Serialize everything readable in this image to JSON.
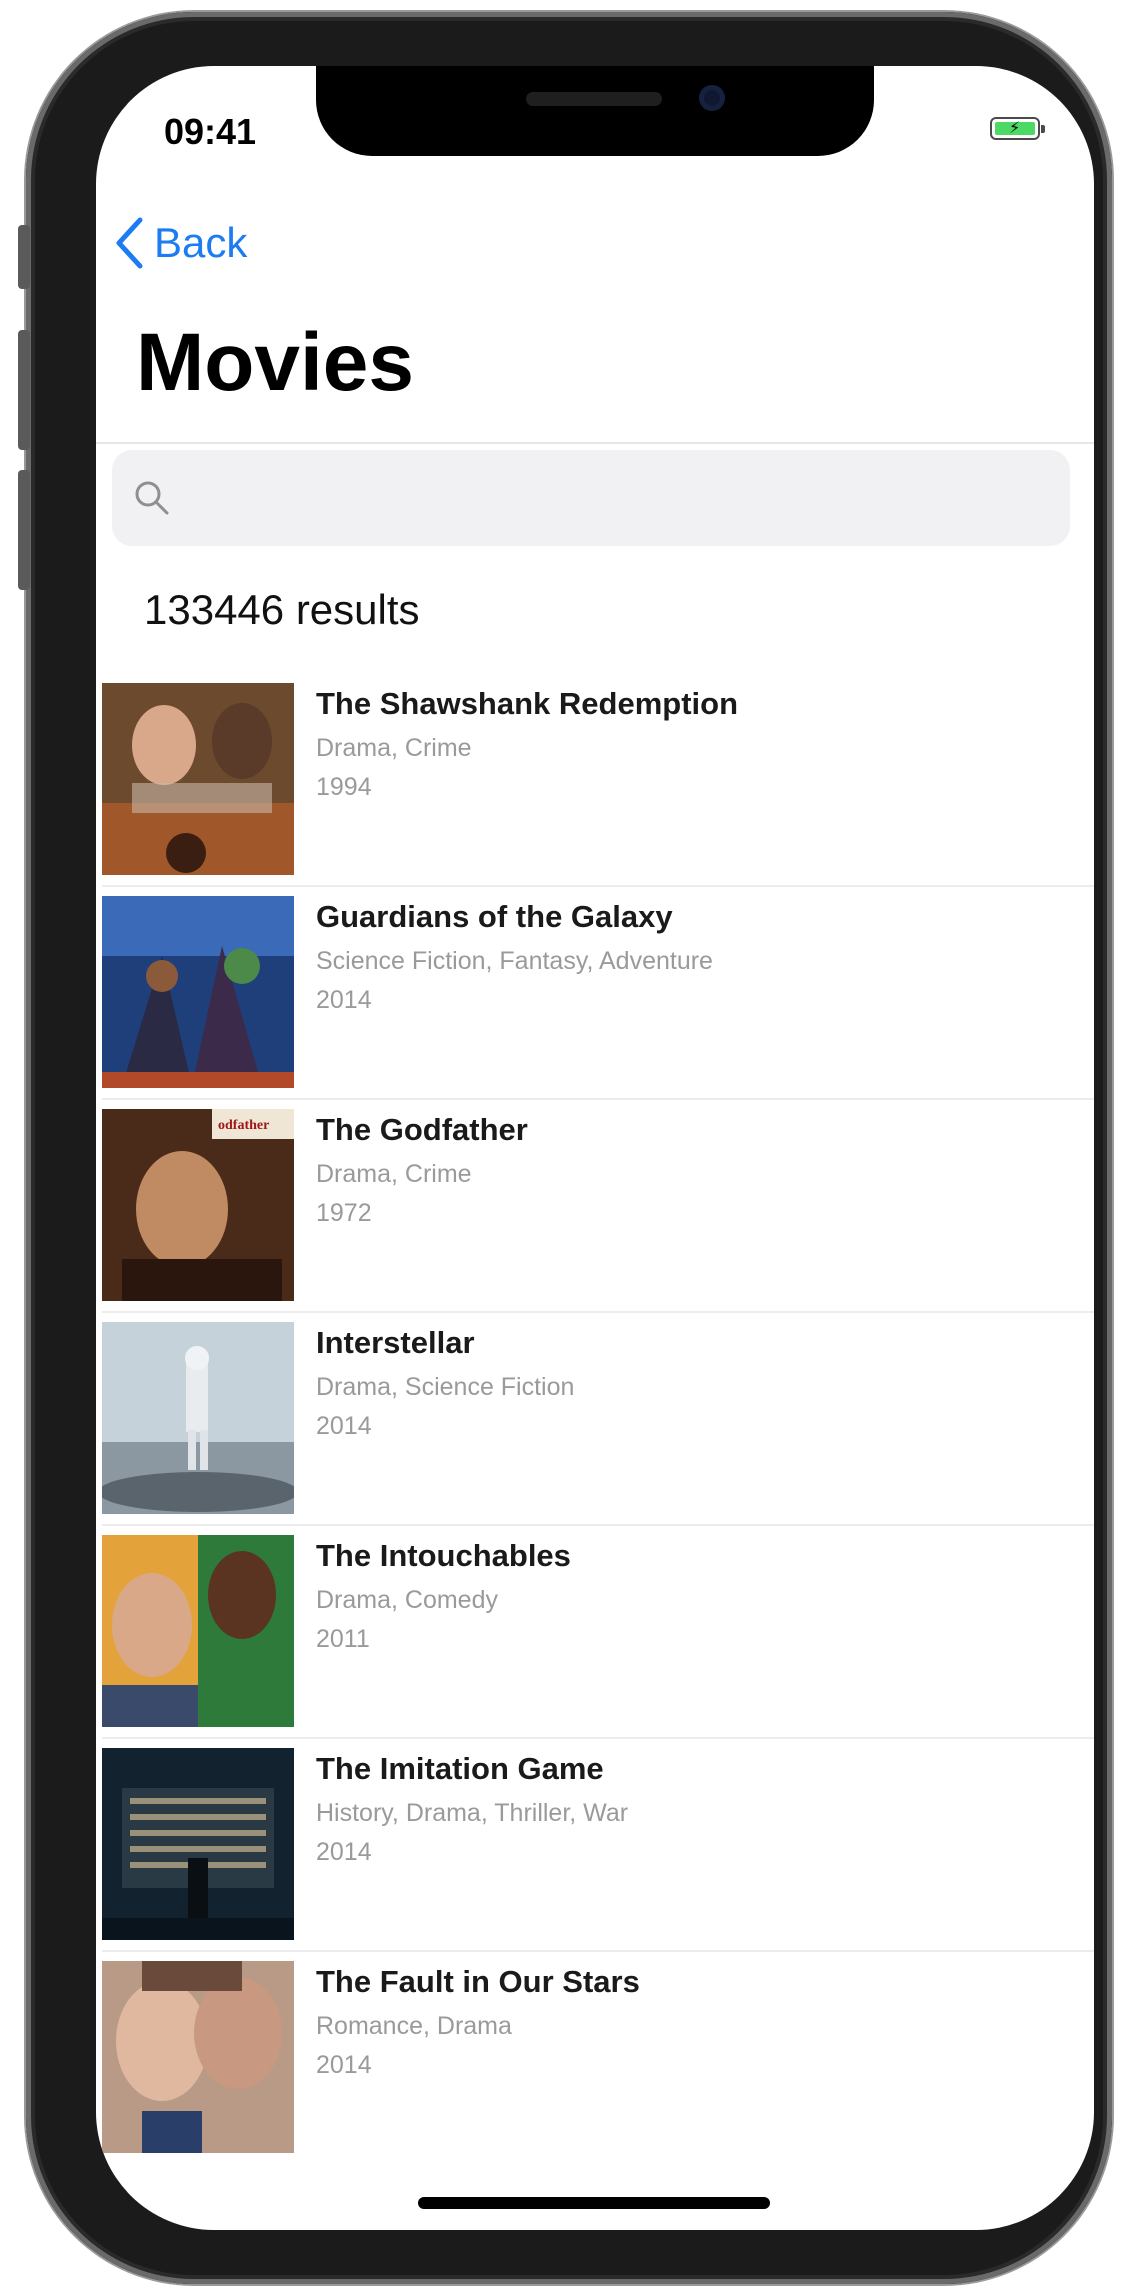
{
  "status_bar": {
    "time": "09:41",
    "battery_color": "#4cd964"
  },
  "nav": {
    "back_label": "Back",
    "back_icon": "chevron-left-icon",
    "accent_color": "#1e7cf2"
  },
  "title": "Movies",
  "search": {
    "placeholder": "",
    "value": "",
    "icon": "search-icon"
  },
  "results_label": "133446 results",
  "movies": [
    {
      "title": "The Shawshank Redemption",
      "genres": "Drama, Crime",
      "year": "1994"
    },
    {
      "title": "Guardians of the Galaxy",
      "genres": "Science Fiction, Fantasy, Adventure",
      "year": "2014"
    },
    {
      "title": "The Godfather",
      "genres": "Drama, Crime",
      "year": "1972"
    },
    {
      "title": "Interstellar",
      "genres": "Drama, Science Fiction",
      "year": "2014"
    },
    {
      "title": "The Intouchables",
      "genres": "Drama, Comedy",
      "year": "2011"
    },
    {
      "title": "The Imitation Game",
      "genres": "History, Drama, Thriller, War",
      "year": "2014"
    },
    {
      "title": "The Fault in Our Stars",
      "genres": "Romance, Drama",
      "year": "2014"
    }
  ]
}
